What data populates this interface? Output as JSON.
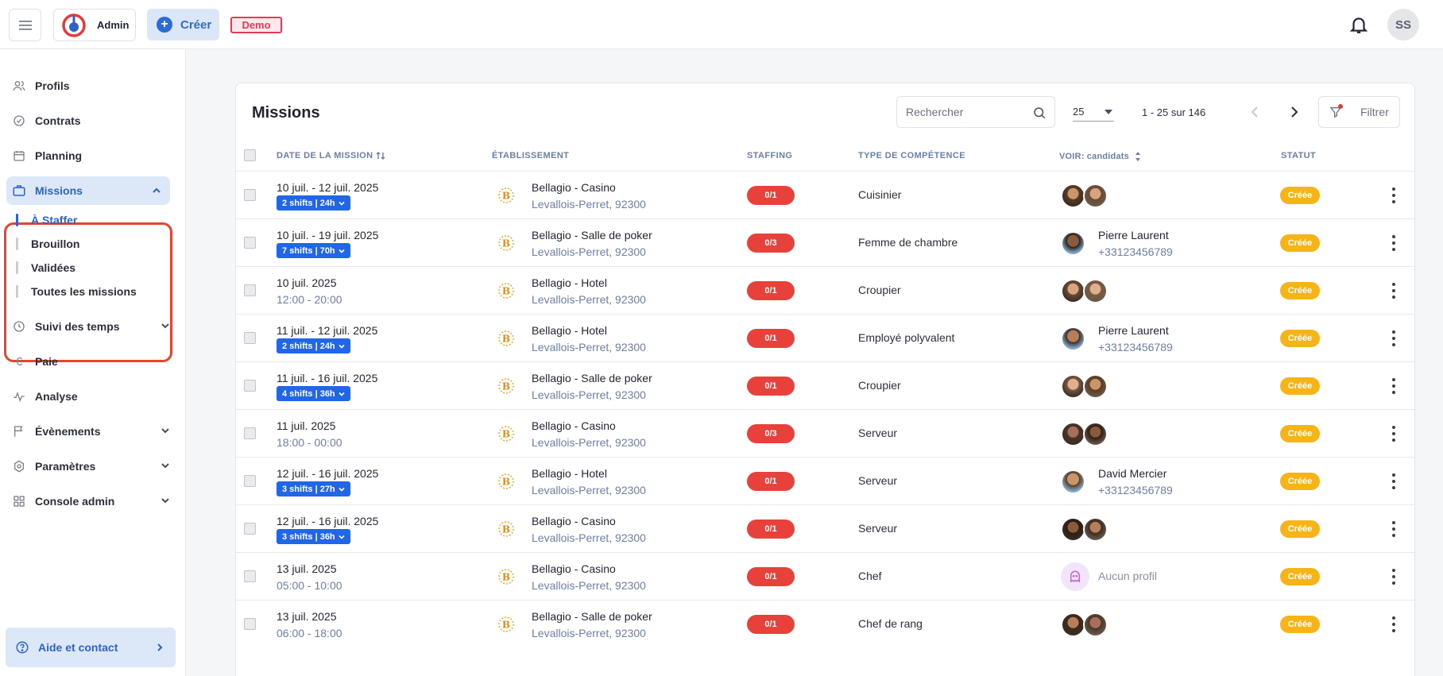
{
  "header": {
    "admin_label": "Admin",
    "create_label": "Créer",
    "demo_badge": "Demo",
    "user_initials": "SS"
  },
  "sidebar": {
    "items": [
      {
        "label": "Profils",
        "icon": "users-icon"
      },
      {
        "label": "Contrats",
        "icon": "check-circle-icon"
      },
      {
        "label": "Planning",
        "icon": "calendar-icon"
      },
      {
        "label": "Missions",
        "icon": "briefcase-icon"
      },
      {
        "label": "Suivi des temps",
        "icon": "clock-icon"
      },
      {
        "label": "Paie",
        "icon": "euro-icon"
      },
      {
        "label": "Analyse",
        "icon": "activity-icon"
      },
      {
        "label": "Évènements",
        "icon": "flag-icon"
      },
      {
        "label": "Paramètres",
        "icon": "settings-icon"
      },
      {
        "label": "Console admin",
        "icon": "grid-icon"
      }
    ],
    "missions_sub": [
      "À Staffer",
      "Brouillon",
      "Validées",
      "Toutes les missions"
    ],
    "help_label": "Aide et contact"
  },
  "missions": {
    "title": "Missions",
    "search_placeholder": "Rechercher",
    "page_size": "25",
    "range": "1 - 25 sur 146",
    "filter_label": "Filtrer",
    "columns": [
      "DATE DE LA MISSION",
      "ÉTABLISSEMENT",
      "STAFFING",
      "TYPE DE COMPÉTENCE",
      "VOIR: candidats",
      "STATUT"
    ],
    "rows": [
      {
        "date": "10 juil. - 12 juil. 2025",
        "shifts": "2 shifts | 24h",
        "time": "",
        "est_name": "Bellagio - Casino",
        "est_addr": "Levallois-Perret, 92300",
        "staffing": "0/1",
        "skill": "Cuisinier",
        "cand_name": "",
        "cand_phone": "",
        "status": "Créée"
      },
      {
        "date": "10 juil. - 19 juil. 2025",
        "shifts": "7 shifts | 70h",
        "time": "",
        "est_name": "Bellagio - Salle de poker",
        "est_addr": "Levallois-Perret, 92300",
        "staffing": "0/3",
        "skill": "Femme de chambre",
        "cand_name": "Pierre Laurent",
        "cand_phone": "+33123456789",
        "status": "Créée"
      },
      {
        "date": "10 juil. 2025",
        "shifts": "",
        "time": "12:00 - 20:00",
        "est_name": "Bellagio - Hotel",
        "est_addr": "Levallois-Perret, 92300",
        "staffing": "0/1",
        "skill": "Croupier",
        "cand_name": "",
        "cand_phone": "",
        "status": "Créée"
      },
      {
        "date": "11 juil. - 12 juil. 2025",
        "shifts": "2 shifts | 24h",
        "time": "",
        "est_name": "Bellagio - Hotel",
        "est_addr": "Levallois-Perret, 92300",
        "staffing": "0/1",
        "skill": "Employé polyvalent",
        "cand_name": "Pierre Laurent",
        "cand_phone": "+33123456789",
        "status": "Créée"
      },
      {
        "date": "11 juil. - 16 juil. 2025",
        "shifts": "4 shifts | 36h",
        "time": "",
        "est_name": "Bellagio - Salle de poker",
        "est_addr": "Levallois-Perret, 92300",
        "staffing": "0/1",
        "skill": "Croupier",
        "cand_name": "",
        "cand_phone": "",
        "status": "Créée"
      },
      {
        "date": "11 juil. 2025",
        "shifts": "",
        "time": "18:00 - 00:00",
        "est_name": "Bellagio - Casino",
        "est_addr": "Levallois-Perret, 92300",
        "staffing": "0/3",
        "skill": "Serveur",
        "cand_name": "",
        "cand_phone": "",
        "status": "Créée"
      },
      {
        "date": "12 juil. - 16 juil. 2025",
        "shifts": "3 shifts | 27h",
        "time": "",
        "est_name": "Bellagio - Hotel",
        "est_addr": "Levallois-Perret, 92300",
        "staffing": "0/1",
        "skill": "Serveur",
        "cand_name": "David Mercier",
        "cand_phone": "+33123456789",
        "status": "Créée"
      },
      {
        "date": "12 juil. - 16 juil. 2025",
        "shifts": "3 shifts | 36h",
        "time": "",
        "est_name": "Bellagio - Casino",
        "est_addr": "Levallois-Perret, 92300",
        "staffing": "0/1",
        "skill": "Serveur",
        "cand_name": "",
        "cand_phone": "",
        "status": "Créée"
      },
      {
        "date": "13 juil. 2025",
        "shifts": "",
        "time": "05:00 - 10:00",
        "est_name": "Bellagio - Casino",
        "est_addr": "Levallois-Perret, 92300",
        "staffing": "0/1",
        "skill": "Chef",
        "cand_name": "Aucun profil",
        "cand_phone": "",
        "status": "Créée"
      },
      {
        "date": "13 juil. 2025",
        "shifts": "",
        "time": "06:00 - 18:00",
        "est_name": "Bellagio - Salle de poker",
        "est_addr": "Levallois-Perret, 92300",
        "staffing": "0/1",
        "skill": "Chef de rang",
        "cand_name": "",
        "cand_phone": "",
        "status": "Créée"
      }
    ]
  },
  "colors": {
    "accent": "#2d63c8",
    "staffing_red": "#e8403b",
    "status_yellow": "#f7b416",
    "shift_blue": "#2166e6",
    "highlight_red": "#e8432e"
  }
}
